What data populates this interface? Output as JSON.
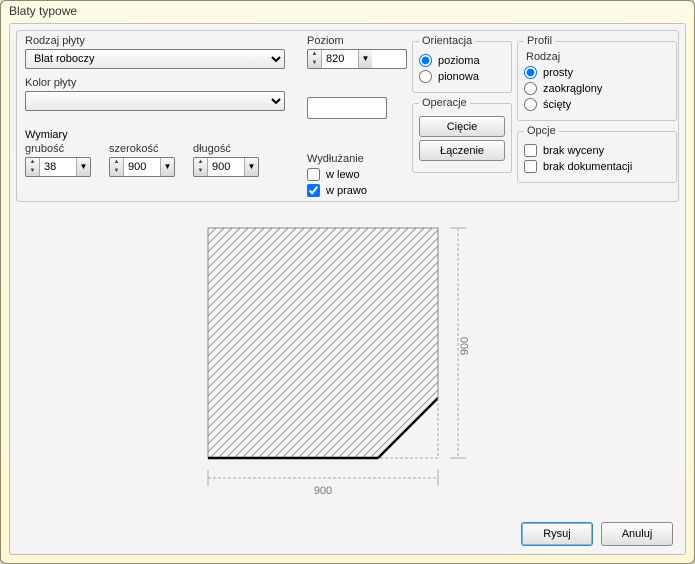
{
  "title": "Blaty typowe",
  "labels": {
    "rodzaj_plyty": "Rodzaj płyty",
    "kolor_plyty": "Kolor płyty",
    "poziom": "Poziom",
    "orientacja": "Orientacja",
    "pozioma": "pozioma",
    "pionowa": "pionowa",
    "operacje": "Operacje",
    "ciecie": "Cięcie",
    "laczenie": "Łączenie",
    "profil": "Profil",
    "rodzaj": "Rodzaj",
    "prosty": "prosty",
    "zaokraglony": "zaokrąglony",
    "sciety": "ścięty",
    "opcje": "Opcje",
    "brak_wyceny": "brak wyceny",
    "brak_dokumentacji": "brak dokumentacji",
    "wymiary": "Wymiary",
    "grubosc": "grubość",
    "szerokosc": "szerokość",
    "dlugosc": "długość",
    "wydluzanie": "Wydłużanie",
    "w_lewo": "w lewo",
    "w_prawo": "w prawo"
  },
  "values": {
    "rodzaj_plyty": "Blat roboczy",
    "kolor_plyty": "",
    "poziom": "820",
    "grubosc": "38",
    "szerokosc": "900",
    "dlugosc": "900",
    "w_lewo": false,
    "w_prawo": true,
    "orientacja": "pozioma",
    "profil": "prosty",
    "brak_wyceny": false,
    "brak_dokumentacji": false
  },
  "preview": {
    "dim_h": "900",
    "dim_v": "900"
  },
  "buttons": {
    "rysuj": "Rysuj",
    "anuluj": "Anuluj"
  }
}
